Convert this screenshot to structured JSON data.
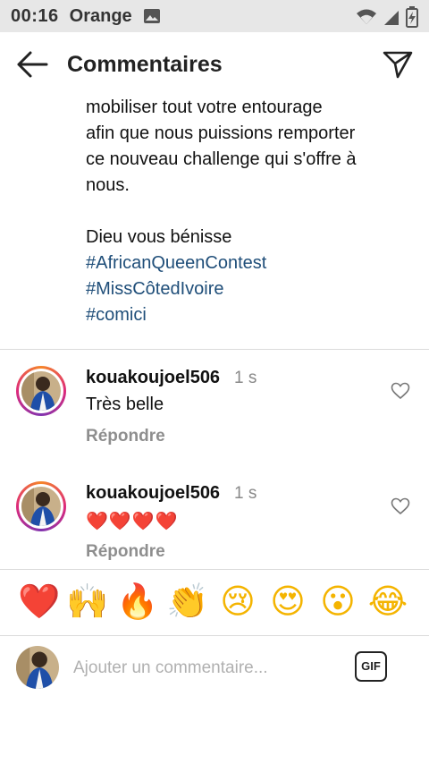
{
  "status_bar": {
    "time": "00:16",
    "carrier": "Orange"
  },
  "header": {
    "title": "Commentaires"
  },
  "caption": {
    "lines": [
      "mobiliser tout votre entourage",
      "afin que nous puissions remporter",
      "ce nouveau challenge qui s'offre à",
      "nous."
    ],
    "blessing": "Dieu vous bénisse",
    "hashtags": [
      "#AfricanQueenContest",
      "#MissCôtedIvoire",
      "#comici"
    ]
  },
  "comments": [
    {
      "username": "kouakoujoel506",
      "time": "1 s",
      "text": "Très belle",
      "reply_label": "Répondre"
    },
    {
      "username": "kouakoujoel506",
      "time": "1 s",
      "text": "❤️❤️❤️❤️",
      "reply_label": "Répondre"
    }
  ],
  "emoji_bar": [
    "❤️",
    "🙌",
    "🔥",
    "👏",
    "😢",
    "😍",
    "😮",
    "😂"
  ],
  "composer": {
    "placeholder": "Ajouter un commentaire...",
    "gif_label": "GIF"
  },
  "colors": {
    "hashtag": "#1f4e79",
    "secondary_text": "#8e8e8e",
    "story_ring": "#dd2a7b"
  }
}
